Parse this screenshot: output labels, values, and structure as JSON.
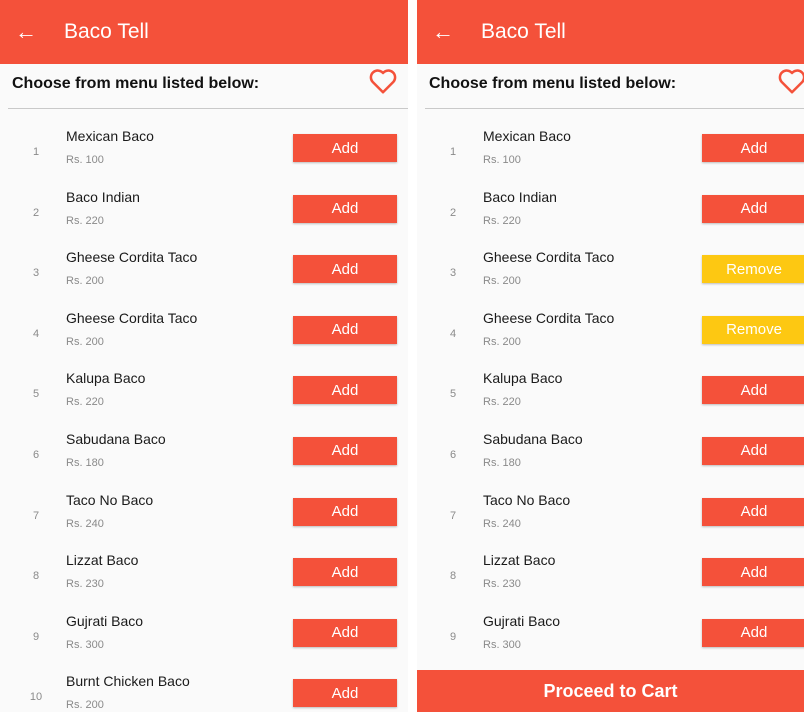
{
  "colors": {
    "accent": "#f4513a",
    "remove": "#fdc812",
    "heart": "#f4513a"
  },
  "app": {
    "title": "Baco Tell",
    "subtitle": "Choose from menu listed below:",
    "back_icon": "arrow-left-icon",
    "favorite_icon": "heart-outline-icon"
  },
  "screens": [
    {
      "items": [
        {
          "num": "1",
          "name": "Mexican Baco",
          "price": "Rs. 100",
          "action": "Add"
        },
        {
          "num": "2",
          "name": "Baco Indian",
          "price": "Rs. 220",
          "action": "Add"
        },
        {
          "num": "3",
          "name": "Gheese Cordita Taco",
          "price": "Rs. 200",
          "action": "Add"
        },
        {
          "num": "4",
          "name": "Gheese Cordita Taco",
          "price": "Rs. 200",
          "action": "Add"
        },
        {
          "num": "5",
          "name": "Kalupa Baco",
          "price": "Rs. 220",
          "action": "Add"
        },
        {
          "num": "6",
          "name": "Sabudana Baco",
          "price": "Rs. 180",
          "action": "Add"
        },
        {
          "num": "7",
          "name": "Taco No Baco",
          "price": "Rs. 240",
          "action": "Add"
        },
        {
          "num": "8",
          "name": "Lizzat Baco",
          "price": "Rs. 230",
          "action": "Add"
        },
        {
          "num": "9",
          "name": "Gujrati Baco",
          "price": "Rs. 300",
          "action": "Add"
        },
        {
          "num": "10",
          "name": "Burnt Chicken Baco",
          "price": "Rs. 200",
          "action": "Add"
        }
      ]
    },
    {
      "items": [
        {
          "num": "1",
          "name": "Mexican Baco",
          "price": "Rs. 100",
          "action": "Add"
        },
        {
          "num": "2",
          "name": "Baco Indian",
          "price": "Rs. 220",
          "action": "Add"
        },
        {
          "num": "3",
          "name": "Gheese Cordita Taco",
          "price": "Rs. 200",
          "action": "Remove"
        },
        {
          "num": "4",
          "name": "Gheese Cordita Taco",
          "price": "Rs. 200",
          "action": "Remove"
        },
        {
          "num": "5",
          "name": "Kalupa Baco",
          "price": "Rs. 220",
          "action": "Add"
        },
        {
          "num": "6",
          "name": "Sabudana Baco",
          "price": "Rs. 180",
          "action": "Add"
        },
        {
          "num": "7",
          "name": "Taco No Baco",
          "price": "Rs. 240",
          "action": "Add"
        },
        {
          "num": "8",
          "name": "Lizzat Baco",
          "price": "Rs. 230",
          "action": "Add"
        },
        {
          "num": "9",
          "name": "Gujrati Baco",
          "price": "Rs. 300",
          "action": "Add"
        }
      ],
      "cart_label": "Proceed to Cart"
    }
  ]
}
